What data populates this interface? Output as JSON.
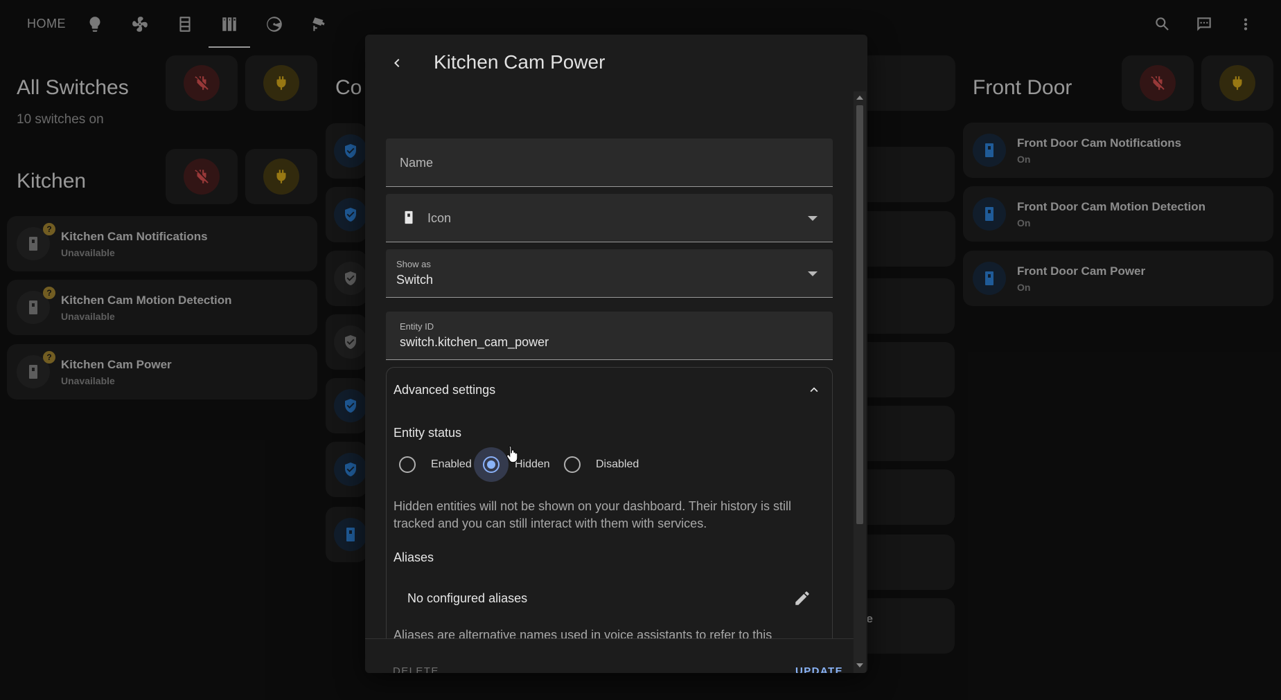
{
  "topbar": {
    "home_label": "HOME",
    "nav_icons": [
      "lightbulb-icon",
      "fan-icon",
      "server-icon",
      "library-icon",
      "dial-icon",
      "cctv-icon"
    ],
    "active_tab_index": 4,
    "actions": [
      "search-icon",
      "assist-icon",
      "more-vert-icon"
    ]
  },
  "dashboard": {
    "all_switches": {
      "title": "All Switches",
      "subtitle": "10 switches on"
    },
    "kitchen": {
      "title": "Kitchen",
      "tiles": [
        {
          "name": "Kitchen Cam Notifications",
          "state": "Unavailable"
        },
        {
          "name": "Kitchen Cam Motion Detection",
          "state": "Unavailable"
        },
        {
          "name": "Kitchen Cam Power",
          "state": "Unavailable"
        }
      ],
      "badge": "?"
    },
    "middle": {
      "title_fragment": "Co",
      "partial_label": "ve"
    },
    "front_door": {
      "title": "Front Door",
      "tiles": [
        {
          "name": "Front Door Cam Notifications",
          "state": "On"
        },
        {
          "name": "Front Door Cam Motion Detection",
          "state": "On"
        },
        {
          "name": "Front Door Cam Power",
          "state": "On"
        }
      ]
    }
  },
  "dialog": {
    "title": "Kitchen Cam Power",
    "name_label": "Name",
    "icon_label": "Icon",
    "show_as_label": "Show as",
    "show_as_value": "Switch",
    "entity_id_label": "Entity ID",
    "entity_id_value": "switch.kitchen_cam_power",
    "advanced_title": "Advanced settings",
    "entity_status_title": "Entity status",
    "status_options": [
      "Enabled",
      "Hidden",
      "Disabled"
    ],
    "status_selected": "Hidden",
    "hidden_help": "Hidden entities will not be shown on your dashboard. Their history is still tracked and you can still interact with them with services.",
    "aliases_title": "Aliases",
    "no_aliases": "No configured aliases",
    "aliases_help": "Aliases are alternative names used in voice assistants to refer to this",
    "delete_label": "DELETE",
    "update_label": "UPDATE"
  },
  "colors": {
    "accent": "#8ab4f8",
    "off_red": "#e05353",
    "on_yellow": "#e0b21c",
    "entity_blue": "#2f86e0"
  }
}
